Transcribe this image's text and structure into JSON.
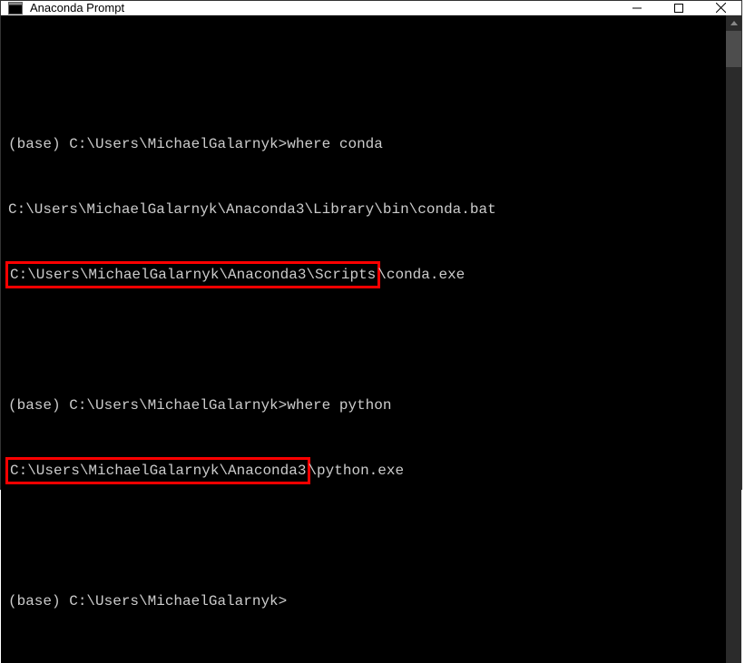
{
  "window": {
    "title": "Anaconda Prompt"
  },
  "terminal": {
    "line1_prompt": "(base) C:\\Users\\MichaelGalarnyk>",
    "line1_cmd": "where conda",
    "line2": "C:\\Users\\MichaelGalarnyk\\Anaconda3\\Library\\bin\\conda.bat",
    "line3_hl": "C:\\Users\\MichaelGalarnyk\\Anaconda3\\Scripts",
    "line3_rest": "\\conda.exe",
    "line4_prompt": "(base) C:\\Users\\MichaelGalarnyk>",
    "line4_cmd": "where python",
    "line5_hl": "C:\\Users\\MichaelGalarnyk\\Anaconda3",
    "line5_rest": "\\python.exe",
    "line6_prompt": "(base) C:\\Users\\MichaelGalarnyk>"
  }
}
